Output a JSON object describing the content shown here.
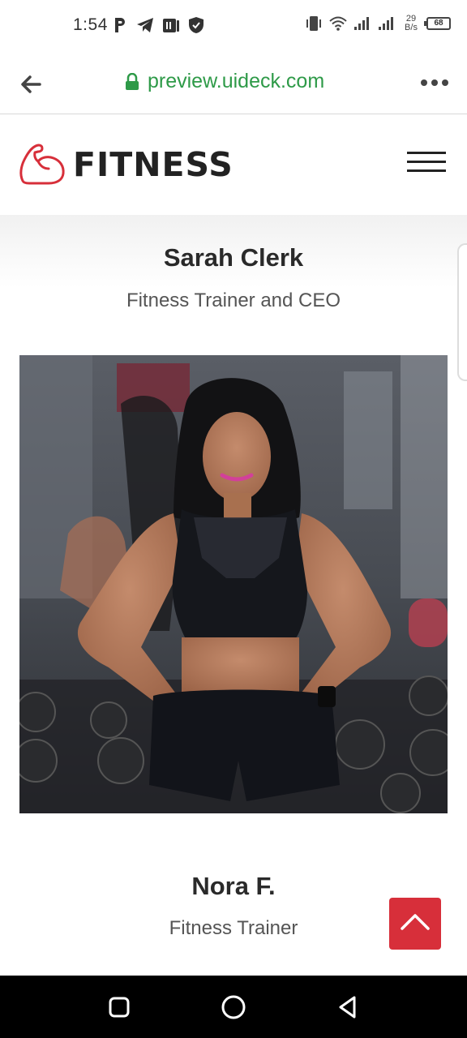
{
  "status_bar": {
    "time": "1:54",
    "icons_left": [
      "parking-icon",
      "telegram-icon",
      "gallery-icon",
      "shield-icon"
    ],
    "net_speed_value": "29",
    "net_speed_unit": "B/s",
    "battery": "68"
  },
  "browser": {
    "url": "preview.uideck.com"
  },
  "header": {
    "brand": "FITNESS"
  },
  "trainers": [
    {
      "name": "Sarah Clerk",
      "role": "Fitness Trainer and CEO"
    },
    {
      "name": "Nora F.",
      "role": "Fitness Trainer"
    }
  ],
  "colors": {
    "accent": "#d72f3a",
    "url_green": "#2e9a48"
  }
}
